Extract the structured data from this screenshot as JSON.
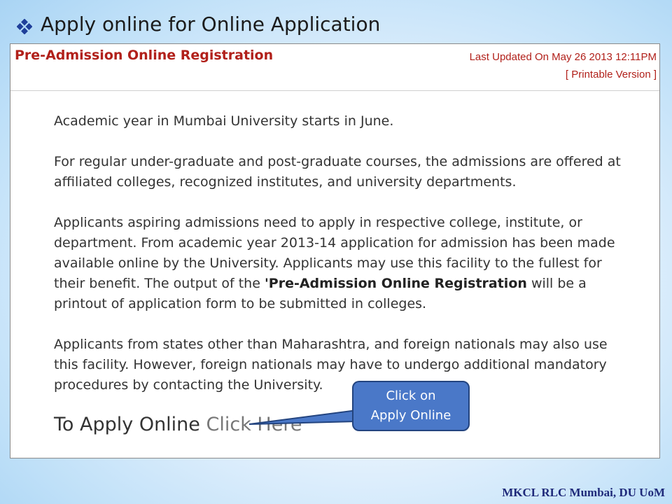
{
  "slide": {
    "title": "Apply online for Online Application",
    "footer": "MKCL RLC Mumbai, DU UoM"
  },
  "page": {
    "title": "Pre-Admission Online Registration",
    "last_updated": "Last Updated On May 26 2013 12:11PM",
    "printable": "[ Printable Version ]"
  },
  "content": {
    "p1": "Academic year in Mumbai University starts in June.",
    "p2": "For regular under-graduate and post-graduate courses, the admissions are offered at affiliated colleges, recognized institutes, and university departments.",
    "p3_before": "Applicants aspiring admissions need to apply in respective college, institute, or department. From academic year 2013-14 application for admission has been made available online by the University. Applicants may use this facility to the fullest for their benefit. The output of the ",
    "p3_bold": "'Pre-Admission Online Registration",
    "p3_after": " will be a printout of application form to be submitted in colleges.",
    "p4": "Applicants from states other than Maharashtra, and foreign nationals may also use this facility. However, foreign nationals may have to undergo additional mandatory procedures by contacting the University."
  },
  "apply": {
    "prefix": "To Apply Online",
    "link": "Click Here"
  },
  "callout": {
    "line1": "Click on",
    "line2": "Apply Online"
  },
  "colors": {
    "accent_red": "#b1201a",
    "callout_blue": "#4a78c8",
    "footer_navy": "#1f2a7a"
  },
  "icons": {
    "bullet": "diamond-bullet-icon"
  }
}
